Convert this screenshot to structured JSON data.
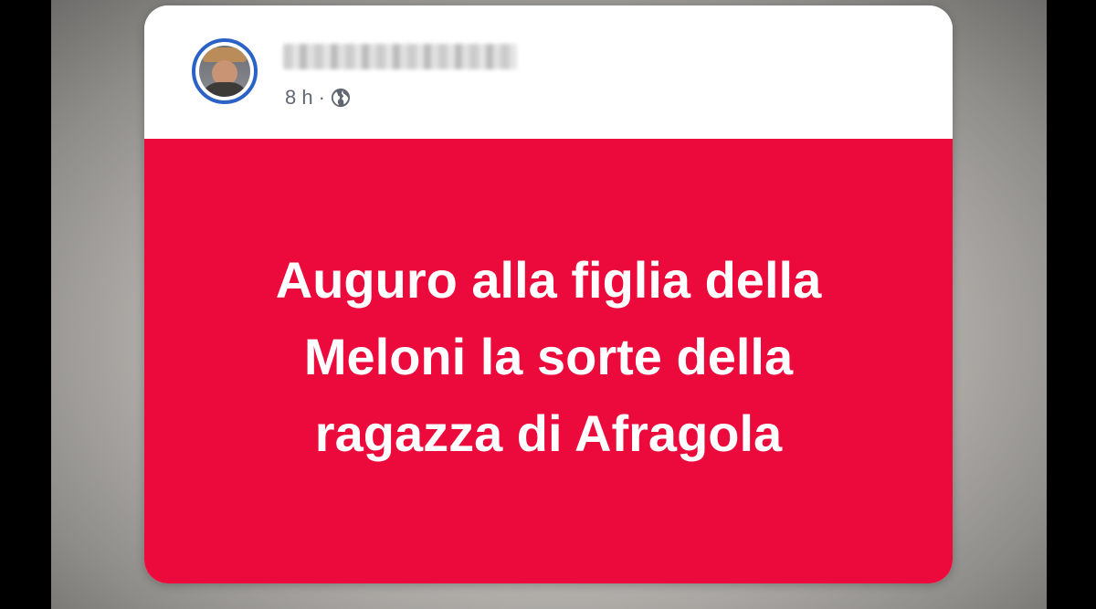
{
  "post": {
    "author_name": "",
    "time": "8 h",
    "separator": "·",
    "visibility_icon": "globe-icon",
    "text": "Auguro alla figlia della Meloni la sorte della ragazza di Afragola",
    "background_color": "#ec0a3c",
    "text_color": "#ffffff"
  },
  "avatar": {
    "ring_color": "#2a62c6"
  }
}
